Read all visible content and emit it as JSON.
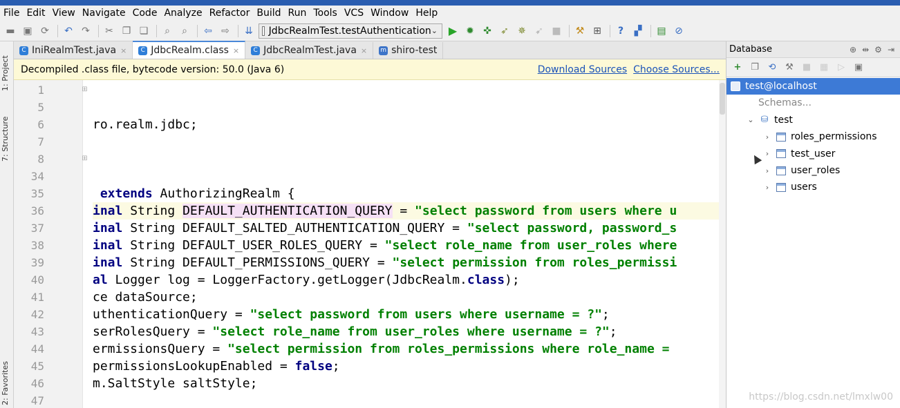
{
  "menu": [
    "File",
    "Edit",
    "View",
    "Navigate",
    "Code",
    "Analyze",
    "Refactor",
    "Build",
    "Run",
    "Tools",
    "VCS",
    "Window",
    "Help"
  ],
  "toolbar": {
    "run_config": "JdbcRealmTest.testAuthentication",
    "icons_left": [
      "open-icon",
      "save-icon",
      "sync-icon",
      "undo-icon",
      "redo-icon",
      "cut-icon",
      "copy-icon",
      "paste-icon",
      "find-icon",
      "replace-icon",
      "back-icon",
      "forward-icon",
      "build-icon"
    ],
    "icons_right": [
      "run-icon",
      "debug-icon",
      "coverage-icon",
      "profile-icon",
      "attach-icon",
      "stop-icon",
      "pause-icon",
      "project-structure-icon",
      "sdk-icon",
      "help-icon",
      "vcs-icon",
      "database-icon",
      "no-icon"
    ]
  },
  "left_strip": {
    "project_tab": "1: Project",
    "structure_tab": "7: Structure",
    "favorites_tab": "2: Favorites"
  },
  "tabs": [
    {
      "label": "IniRealmTest.java",
      "active": false,
      "icon_color": "#2f7ed8",
      "icon_glyph": "C"
    },
    {
      "label": "JdbcRealm.class",
      "active": true,
      "icon_color": "#2f7ed8",
      "icon_glyph": "C"
    },
    {
      "label": "JdbcRealmTest.java",
      "active": false,
      "icon_color": "#2f7ed8",
      "icon_glyph": "C"
    },
    {
      "label": "shiro-test",
      "active": false,
      "icon_color": "#3d74c8",
      "icon_glyph": "m"
    }
  ],
  "banner": {
    "message": "Decompiled .class file, bytecode version: 50.0 (Java 6)",
    "download_sources": "Download Sources",
    "choose_sources": "Choose Sources..."
  },
  "editor": {
    "current_line": 36,
    "lines": [
      {
        "num": "1",
        "fold": true,
        "parts": []
      },
      {
        "num": "5",
        "fold": false,
        "parts": []
      },
      {
        "num": "6",
        "fold": false,
        "parts": [
          {
            "t": "ro.realm.jdbc;",
            "c": ""
          }
        ]
      },
      {
        "num": "7",
        "fold": false,
        "parts": []
      },
      {
        "num": "8",
        "fold": true,
        "parts": []
      },
      {
        "num": "34",
        "fold": false,
        "parts": []
      },
      {
        "num": "35",
        "fold": false,
        "parts": [
          {
            "t": " extends",
            "c": "kw"
          },
          {
            "t": " AuthorizingRealm {",
            "c": ""
          }
        ]
      },
      {
        "num": "36",
        "fold": false,
        "parts": [
          {
            "t": "inal",
            "c": "kw"
          },
          {
            "t": " String ",
            "c": ""
          },
          {
            "t": "DEFAULT_AUTHENTICATION_QUERY",
            "c": "hl"
          },
          {
            "t": " = ",
            "c": ""
          },
          {
            "t": "\"select password from users where u",
            "c": "str"
          }
        ]
      },
      {
        "num": "37",
        "fold": false,
        "parts": [
          {
            "t": "inal",
            "c": "kw"
          },
          {
            "t": " String DEFAULT_SALTED_AUTHENTICATION_QUERY = ",
            "c": ""
          },
          {
            "t": "\"select password, password_s",
            "c": "str"
          }
        ]
      },
      {
        "num": "38",
        "fold": false,
        "parts": [
          {
            "t": "inal",
            "c": "kw"
          },
          {
            "t": " String DEFAULT_USER_ROLES_QUERY = ",
            "c": ""
          },
          {
            "t": "\"select role_name from user_roles where",
            "c": "str"
          }
        ]
      },
      {
        "num": "39",
        "fold": false,
        "parts": [
          {
            "t": "inal",
            "c": "kw"
          },
          {
            "t": " String DEFAULT_PERMISSIONS_QUERY = ",
            "c": ""
          },
          {
            "t": "\"select permission from roles_permissi",
            "c": "str"
          }
        ]
      },
      {
        "num": "40",
        "fold": false,
        "parts": [
          {
            "t": "al",
            "c": "kw"
          },
          {
            "t": " Logger log = LoggerFactory.getLogger(JdbcRealm.",
            "c": ""
          },
          {
            "t": "class",
            "c": "kw"
          },
          {
            "t": ");",
            "c": ""
          }
        ]
      },
      {
        "num": "41",
        "fold": false,
        "parts": [
          {
            "t": "ce dataSource;",
            "c": ""
          }
        ]
      },
      {
        "num": "42",
        "fold": false,
        "parts": [
          {
            "t": "uthenticationQuery = ",
            "c": ""
          },
          {
            "t": "\"select password from users where username = ?\"",
            "c": "str"
          },
          {
            "t": ";",
            "c": ""
          }
        ]
      },
      {
        "num": "43",
        "fold": false,
        "parts": [
          {
            "t": "serRolesQuery = ",
            "c": ""
          },
          {
            "t": "\"select role_name from user_roles where username = ?\"",
            "c": "str"
          },
          {
            "t": ";",
            "c": ""
          }
        ]
      },
      {
        "num": "44",
        "fold": false,
        "parts": [
          {
            "t": "ermissionsQuery = ",
            "c": ""
          },
          {
            "t": "\"select permission from roles_permissions where role_name = ",
            "c": "str"
          }
        ]
      },
      {
        "num": "45",
        "fold": false,
        "parts": [
          {
            "t": "permissionsLookupEnabled = ",
            "c": ""
          },
          {
            "t": "false",
            "c": "kw"
          },
          {
            "t": ";",
            "c": ""
          }
        ]
      },
      {
        "num": "46",
        "fold": false,
        "parts": [
          {
            "t": "m.SaltStyle saltStyle;",
            "c": ""
          }
        ]
      },
      {
        "num": "47",
        "fold": false,
        "parts": []
      }
    ]
  },
  "database": {
    "title": "Database",
    "tree": [
      {
        "label": "test@localhost",
        "depth": 0,
        "kind": "datasource",
        "selected": true,
        "twisty": ""
      },
      {
        "label": "Schemas...",
        "depth": 1,
        "kind": "hint",
        "selected": false,
        "twisty": ""
      },
      {
        "label": "test",
        "depth": 1,
        "kind": "schema",
        "selected": false,
        "twisty": "⌄"
      },
      {
        "label": "roles_permissions",
        "depth": 2,
        "kind": "table",
        "selected": false,
        "twisty": "›"
      },
      {
        "label": "test_user",
        "depth": 2,
        "kind": "table",
        "selected": false,
        "twisty": "›"
      },
      {
        "label": "user_roles",
        "depth": 2,
        "kind": "table",
        "selected": false,
        "twisty": "›"
      },
      {
        "label": "users",
        "depth": 2,
        "kind": "table",
        "selected": false,
        "twisty": "›"
      }
    ]
  },
  "watermark": "https://blog.csdn.net/lmxlw00"
}
